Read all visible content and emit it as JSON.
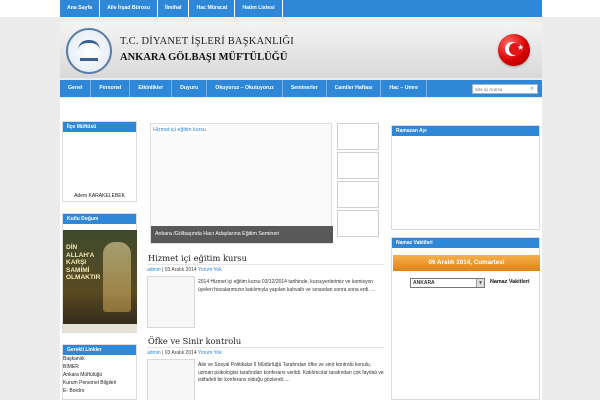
{
  "top_nav": [
    "Ana Sayfa",
    "Aile İrşad Bürosu",
    "İlmihal",
    "Hac Müracat",
    "Hatim Listesi"
  ],
  "header": {
    "line1": "T.C. DİYANET İŞLERİ BAŞKANLIĞI",
    "line2": "ANKARA GÖLBAŞI MÜFTÜLÜĞÜ"
  },
  "main_nav": [
    "Genel",
    "Personel",
    "Etkinlikler",
    "Duyuru",
    "Okuyoruz – Okutuyoruz",
    "Seminerler",
    "Camiler Haftası",
    "Hac – Umre"
  ],
  "search": {
    "placeholder": "Site içi Arama"
  },
  "left": {
    "mufti_title": "İlçe Müftüsü",
    "mufti_name": "Adem KARAKELEBEK",
    "kutlu_title": "Kutlu Doğum",
    "book_title": "DİN ALLAH'A KARŞI SAMİMİ OLMAKTIR",
    "links_title": "Gerekli Linkler",
    "links": [
      "Başkanlık",
      "BİMER",
      "Ankara Müftülüğü",
      "Kurum Personel Bilgileri",
      "E- Bordro"
    ]
  },
  "slider": {
    "caption_top": "Hizmet içi eğitim kursu",
    "date": "",
    "caption_bottom": "Ankara /Gölbaşında Hacı Adaylarına Eğitim Semineri"
  },
  "posts": [
    {
      "title": "Hizmet içi eğitim kursu",
      "author": "admin",
      "date": "03 Aralık 2014",
      "comments": "Yorum Yok",
      "text": "2014 Hizmet içi eğitim kursu 03/12/2014 tarihinde, kursuyerlerimiz ve komisyon üyeleri hocalarımızın katılımıyla yapılan kahvaltı ve sınavdan sonra sona erdi. ..."
    },
    {
      "title": "Öfke ve Sinir kontrolu",
      "author": "admin",
      "date": "03 Aralık 2014",
      "comments": "Yorum Yok",
      "text": "Aile ve Sosyal Politikalar İl Müdürlüğü Tarafından öfke ve sinir kontrolü konulu, uzman psikologlar tarafından konferans verildi. Katılımcılar tarafından çok faydalı ve istifadeli bir konferans olduğu gözlendi. ..."
    }
  ],
  "right": {
    "ramazan_title": "Ramazan Ayı",
    "namaz_title": "Namaz Vakitleri",
    "date_line": "06 Aralık 2014, Cumartesi",
    "city": "ANKARA",
    "namaz_label": "Namaz Vakitleri"
  },
  "colors": {
    "accent": "#2f87d8",
    "orange": "#e0821a"
  }
}
